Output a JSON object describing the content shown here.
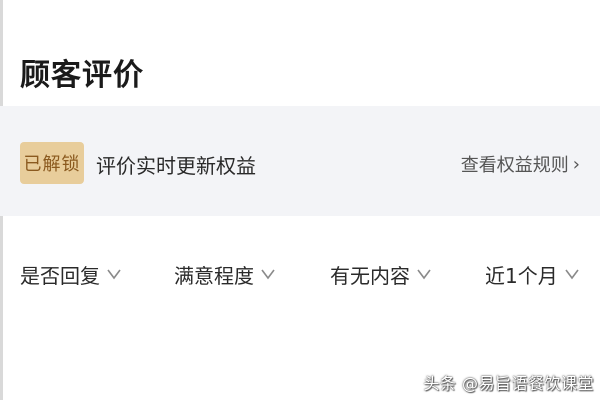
{
  "header": {
    "title": "顾客评价"
  },
  "banner": {
    "badge": "已解锁",
    "text": "评价实时更新权益",
    "link": "查看权益规则"
  },
  "filters": [
    {
      "label": "是否回复"
    },
    {
      "label": "满意程度"
    },
    {
      "label": "有无内容"
    },
    {
      "label": "近1个月"
    }
  ],
  "watermark": "头条 @易旨语餐饮课堂"
}
